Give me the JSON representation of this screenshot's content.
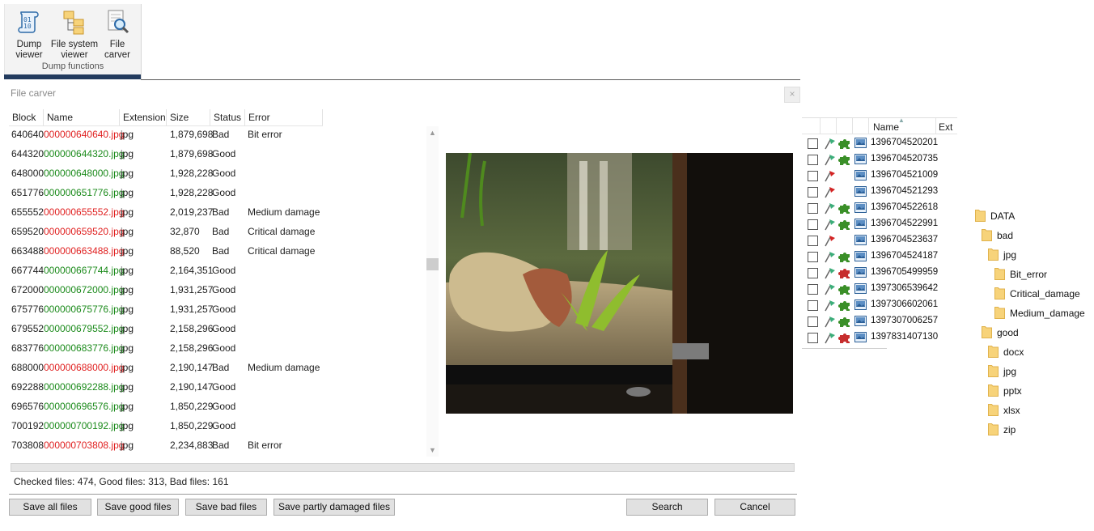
{
  "ribbon": {
    "buttons": [
      {
        "line1": "Dump",
        "line2": "viewer",
        "icon": "binary-scroll-icon"
      },
      {
        "line1": "File system",
        "line2": "viewer",
        "icon": "folder-tree-icon"
      },
      {
        "line1": "File",
        "line2": "carver",
        "icon": "magnifier-document-icon"
      }
    ],
    "group_label": "Dump functions"
  },
  "dialog": {
    "title": "File carver",
    "close_glyph": "×",
    "columns": [
      "Block",
      "Name",
      "Extension",
      "Size",
      "Status",
      "Error"
    ],
    "rows": [
      {
        "block": "640640",
        "name": "000000640640.jpg",
        "ext": "jpg",
        "size": "1,879,698",
        "status": "Bad",
        "error": "Bit error"
      },
      {
        "block": "644320",
        "name": "000000644320.jpg",
        "ext": "jpg",
        "size": "1,879,698",
        "status": "Good",
        "error": ""
      },
      {
        "block": "648000",
        "name": "000000648000.jpg",
        "ext": "jpg",
        "size": "1,928,228",
        "status": "Good",
        "error": ""
      },
      {
        "block": "651776",
        "name": "000000651776.jpg",
        "ext": "jpg",
        "size": "1,928,228",
        "status": "Good",
        "error": ""
      },
      {
        "block": "655552",
        "name": "000000655552.jpg",
        "ext": "jpg",
        "size": "2,019,237",
        "status": "Bad",
        "error": "Medium damage"
      },
      {
        "block": "659520",
        "name": "000000659520.jpg",
        "ext": "jpg",
        "size": "32,870",
        "status": "Bad",
        "error": "Critical damage"
      },
      {
        "block": "663488",
        "name": "000000663488.jpg",
        "ext": "jpg",
        "size": "88,520",
        "status": "Bad",
        "error": "Critical damage"
      },
      {
        "block": "667744",
        "name": "000000667744.jpg",
        "ext": "jpg",
        "size": "2,164,351",
        "status": "Good",
        "error": ""
      },
      {
        "block": "672000",
        "name": "000000672000.jpg",
        "ext": "jpg",
        "size": "1,931,257",
        "status": "Good",
        "error": ""
      },
      {
        "block": "675776",
        "name": "000000675776.jpg",
        "ext": "jpg",
        "size": "1,931,257",
        "status": "Good",
        "error": ""
      },
      {
        "block": "679552",
        "name": "000000679552.jpg",
        "ext": "jpg",
        "size": "2,158,296",
        "status": "Good",
        "error": ""
      },
      {
        "block": "683776",
        "name": "000000683776.jpg",
        "ext": "jpg",
        "size": "2,158,296",
        "status": "Good",
        "error": ""
      },
      {
        "block": "688000",
        "name": "000000688000.jpg",
        "ext": "jpg",
        "size": "2,190,147",
        "status": "Bad",
        "error": "Medium damage"
      },
      {
        "block": "692288",
        "name": "000000692288.jpg",
        "ext": "jpg",
        "size": "2,190,147",
        "status": "Good",
        "error": ""
      },
      {
        "block": "696576",
        "name": "000000696576.jpg",
        "ext": "jpg",
        "size": "1,850,229",
        "status": "Good",
        "error": ""
      },
      {
        "block": "700192",
        "name": "000000700192.jpg",
        "ext": "jpg",
        "size": "1,850,229",
        "status": "Good",
        "error": ""
      },
      {
        "block": "703808",
        "name": "000000703808.jpg",
        "ext": "jpg",
        "size": "2,234,883",
        "status": "Bad",
        "error": "Bit error"
      }
    ],
    "summary": "Checked files: 474, Good files: 313, Bad files: 161",
    "buttons": {
      "save_all": "Save all files",
      "save_good": "Save good files",
      "save_bad": "Save bad files",
      "save_partly": "Save partly damaged files",
      "search": "Search",
      "cancel": "Cancel"
    }
  },
  "file_list": {
    "col_name": "Name",
    "col_ext": "Ext",
    "rows": [
      {
        "name": "1396704520201",
        "flag": "green",
        "puzzle": "green"
      },
      {
        "name": "1396704520735",
        "flag": "green",
        "puzzle": "green"
      },
      {
        "name": "1396704521009",
        "flag": "red",
        "puzzle": "none"
      },
      {
        "name": "1396704521293",
        "flag": "red",
        "puzzle": "none"
      },
      {
        "name": "1396704522618",
        "flag": "green",
        "puzzle": "green"
      },
      {
        "name": "1396704522991",
        "flag": "green",
        "puzzle": "green"
      },
      {
        "name": "1396704523637",
        "flag": "red",
        "puzzle": "none"
      },
      {
        "name": "1396704524187",
        "flag": "green",
        "puzzle": "green"
      },
      {
        "name": "1396705499959",
        "flag": "green",
        "puzzle": "red"
      },
      {
        "name": "1397306539642",
        "flag": "green",
        "puzzle": "green"
      },
      {
        "name": "1397306602061",
        "flag": "green",
        "puzzle": "green"
      },
      {
        "name": "1397307006257",
        "flag": "green",
        "puzzle": "green"
      },
      {
        "name": "1397831407130",
        "flag": "green",
        "puzzle": "red"
      }
    ]
  },
  "tree": [
    {
      "label": "DATA",
      "depth": 0
    },
    {
      "label": "bad",
      "depth": 1
    },
    {
      "label": "jpg",
      "depth": 2
    },
    {
      "label": "Bit_error",
      "depth": 3
    },
    {
      "label": "Critical_damage",
      "depth": 3
    },
    {
      "label": "Medium_damage",
      "depth": 3
    },
    {
      "label": "good",
      "depth": 1
    },
    {
      "label": "docx",
      "depth": 2
    },
    {
      "label": "jpg",
      "depth": 2
    },
    {
      "label": "pptx",
      "depth": 2
    },
    {
      "label": "xlsx",
      "depth": 2
    },
    {
      "label": "zip",
      "depth": 2
    }
  ],
  "colors": {
    "good": "#1a8a1a",
    "bad": "#e02020",
    "accent": "#233b5e",
    "folder": "#f7d37a"
  }
}
